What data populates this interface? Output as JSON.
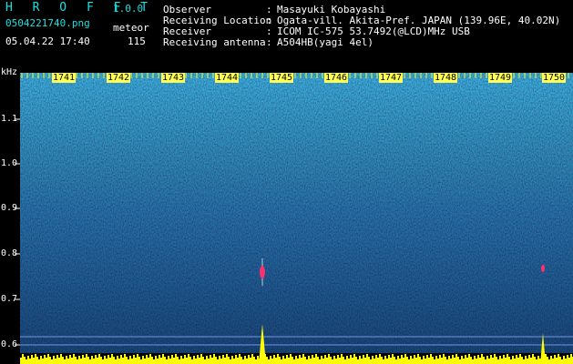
{
  "header": {
    "app_title": "H R O F F T",
    "app_version": "1.0.0",
    "filename": "0504221740.png",
    "mode": "meteor",
    "datetime": "05.04.22 17:40",
    "count": "115",
    "fields": [
      {
        "label": "Observer",
        "value": "Masayuki Kobayashi"
      },
      {
        "label": "Receiving Location",
        "value": "Ogata-vill. Akita-Pref. JAPAN (139.96E, 40.02N)"
      },
      {
        "label": "Receiver",
        "value": "ICOM IC-575 53.7492(@LCD)MHz USB"
      },
      {
        "label": "Receiving antenna",
        "value": "A504HB(yagi 4el)"
      }
    ],
    "separator": ":"
  },
  "spectrogram": {
    "axis_unit": "kHz",
    "freq_ticks": [
      "1.1",
      "1.0",
      "0.9",
      "0.8",
      "0.7",
      "0.6"
    ],
    "time_labels": [
      "1741",
      "1742",
      "1743",
      "1744",
      "1745",
      "1746",
      "1747",
      "1748",
      "1749",
      "1750"
    ],
    "colors": {
      "background": "#0a1a7a",
      "noise_high": "#22c0ff",
      "signal": "#ffff00",
      "meteor": "#ff3070"
    }
  }
}
